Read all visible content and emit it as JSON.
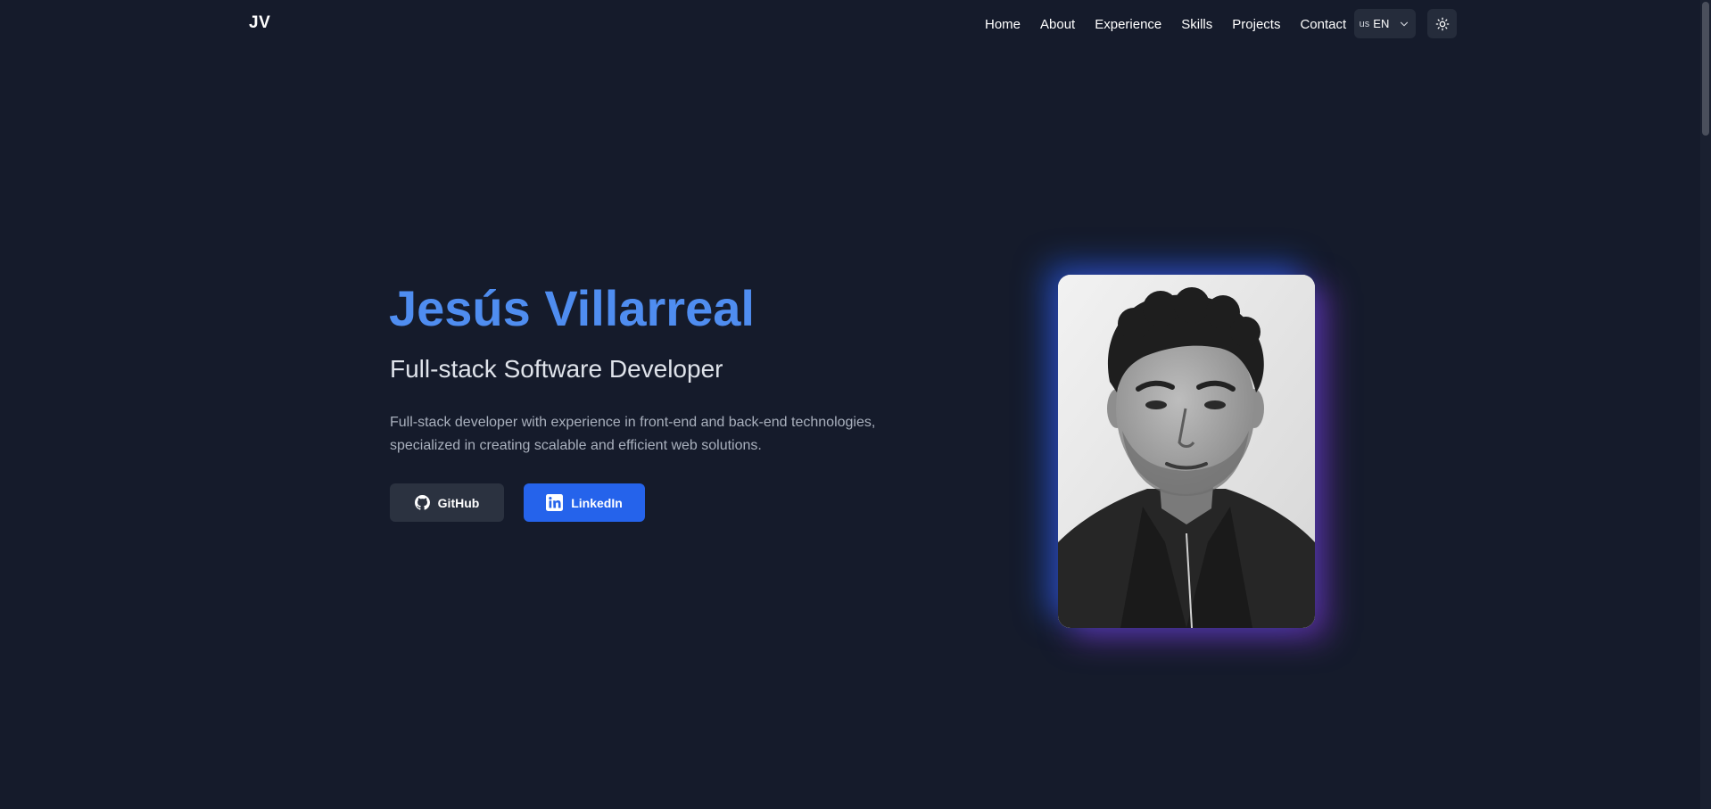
{
  "brand": "JV",
  "nav": {
    "links": [
      "Home",
      "About",
      "Experience",
      "Skills",
      "Projects",
      "Contact"
    ],
    "language": {
      "flag": "us",
      "code": "EN"
    },
    "theme_icon": "sun-icon"
  },
  "hero": {
    "name": "Jesús Villarreal",
    "role": "Full-stack Software Developer",
    "description": "Full-stack developer with experience in front-end and back-end technologies, specialized in creating scalable and efficient web solutions.",
    "buttons": {
      "github": "GitHub",
      "linkedin": "LinkedIn"
    }
  },
  "colors": {
    "background": "#151b2b",
    "accent": "#4f8df0",
    "primary_button": "#2563eb",
    "secondary_button": "#2b3240",
    "glow_blue": "#2864ff",
    "glow_purple": "#8c3ceb"
  }
}
